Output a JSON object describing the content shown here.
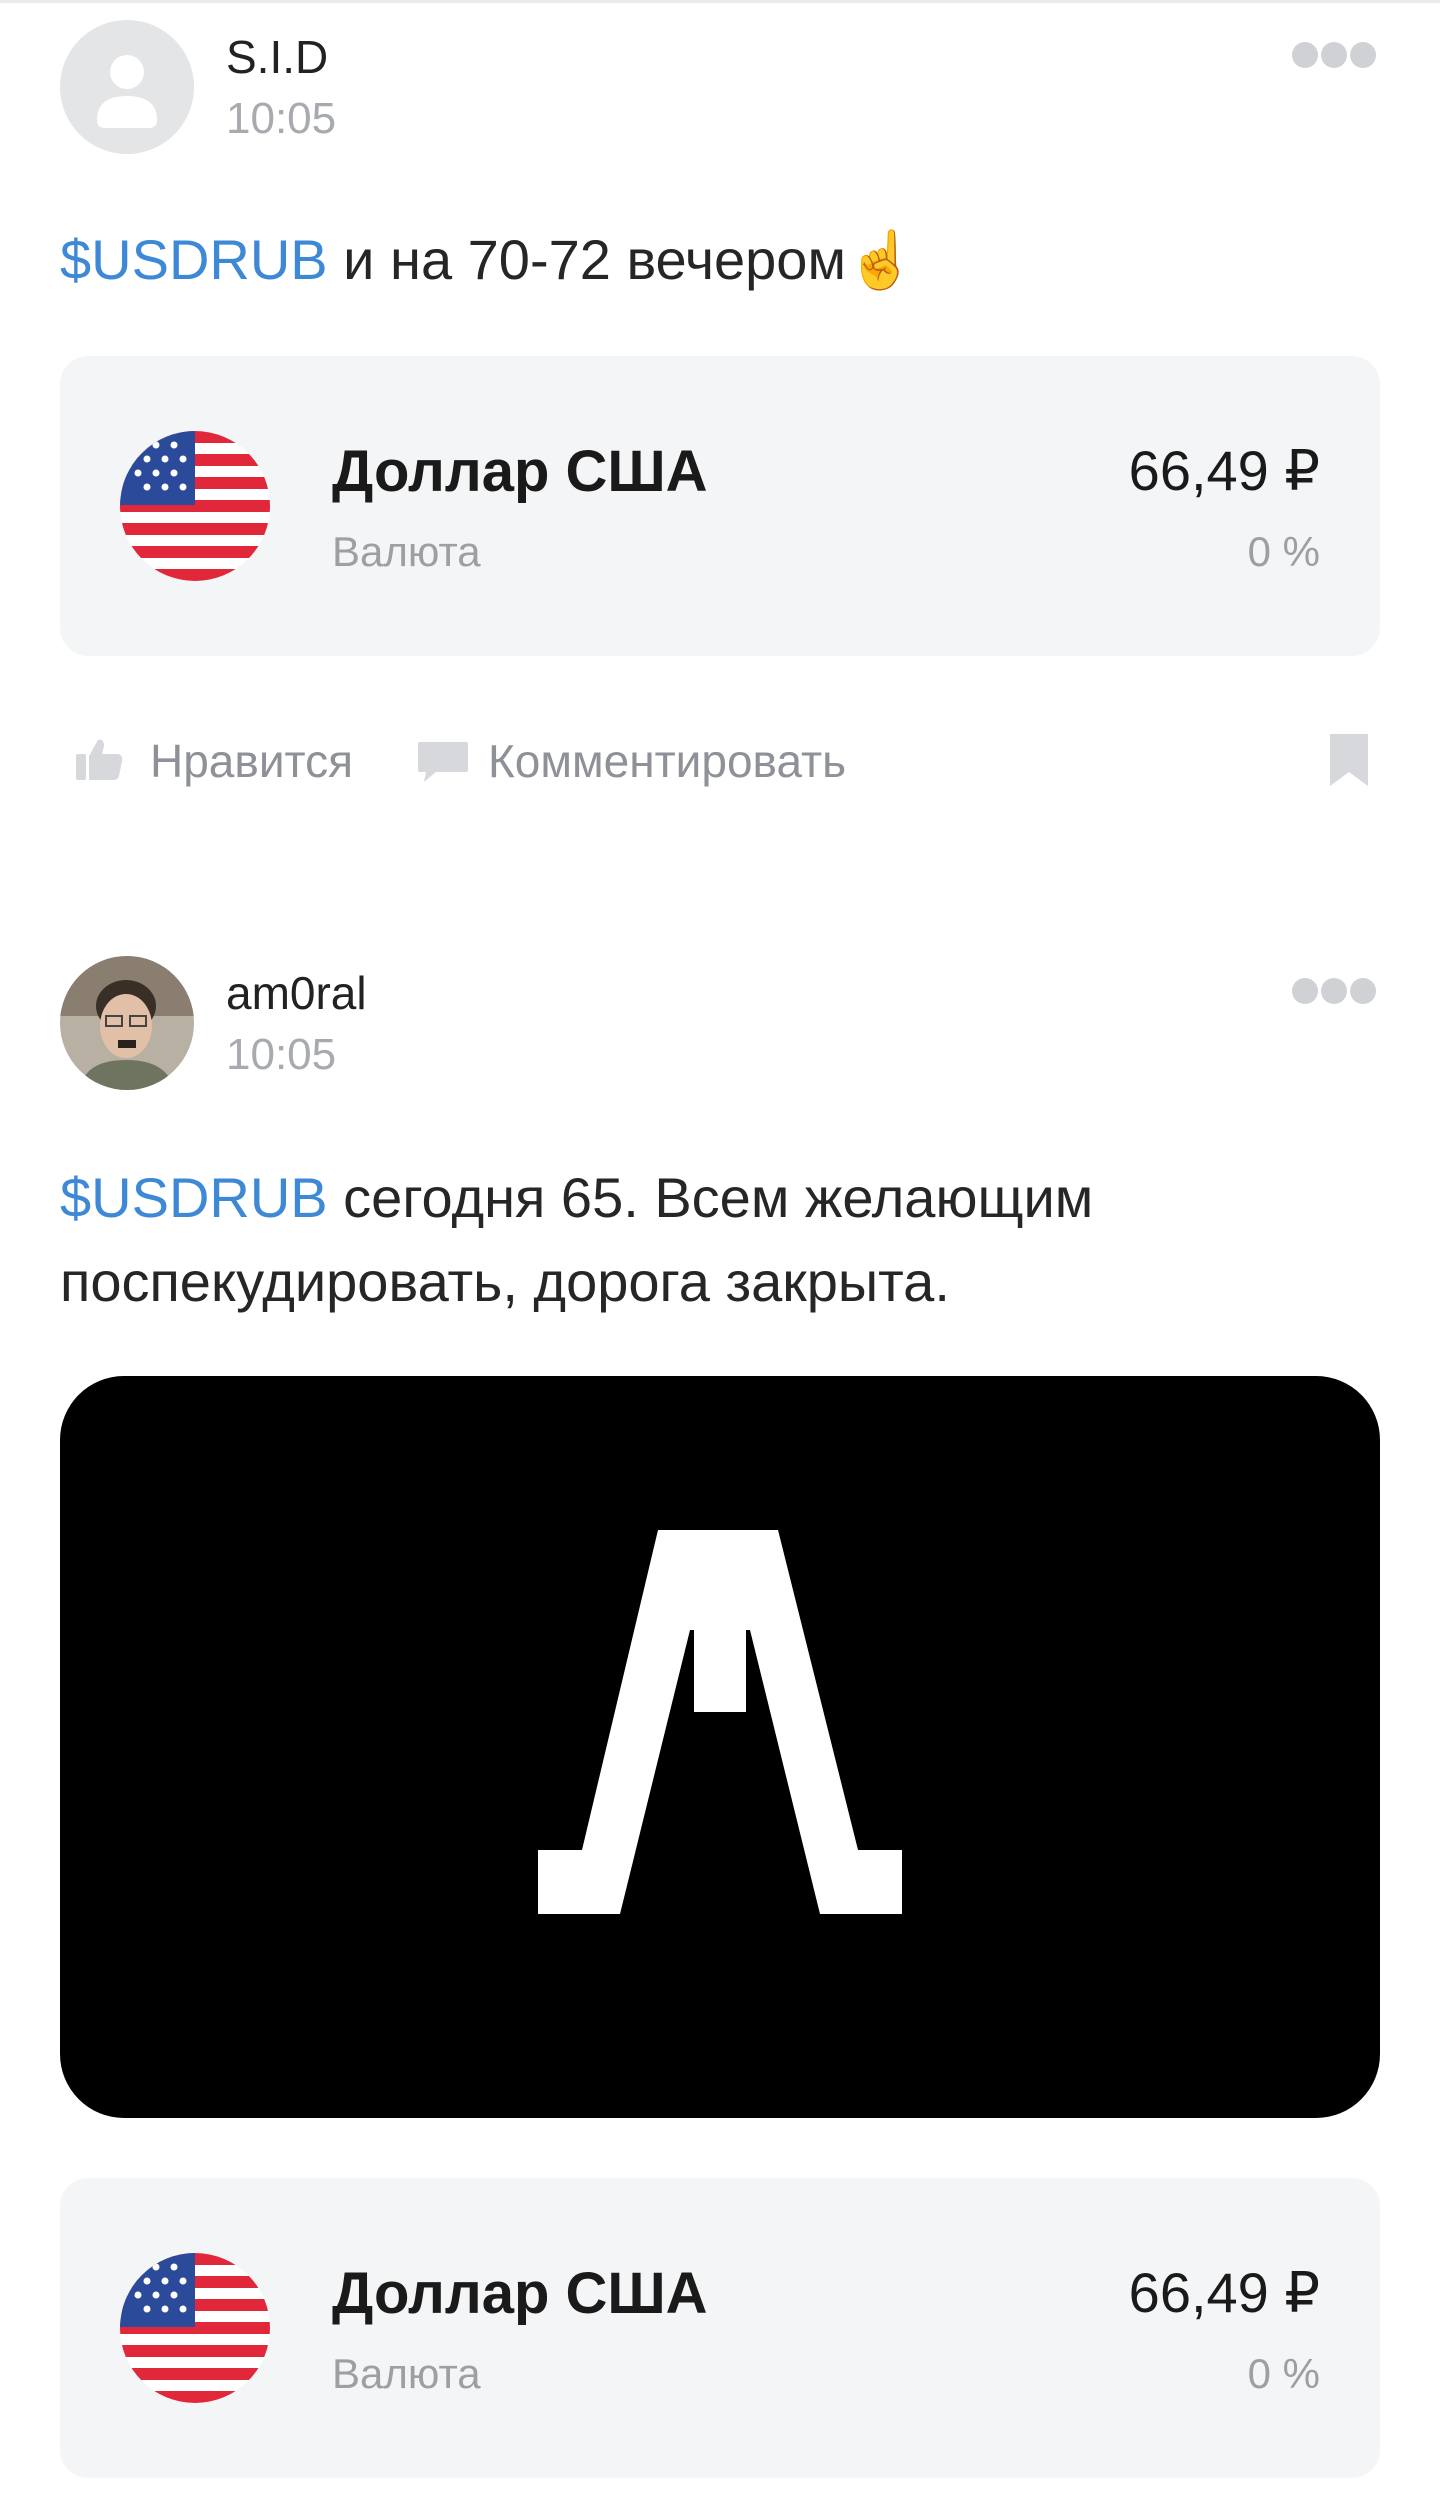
{
  "posts": [
    {
      "author": "S.I.D",
      "time": "10:05",
      "ticker": "$USDRUB",
      "text": " и на 70-72 вечером☝️",
      "instrument": {
        "name": "Доллар США",
        "type": "Валюта",
        "price": "66,49 ₽",
        "change": "0 %"
      },
      "actions": {
        "like": "Нравится",
        "comment": "Комментировать"
      }
    },
    {
      "author": "am0ral",
      "time": "10:05",
      "ticker": "$USDRUB",
      "text": " сегодня 65. Всем желающим поспекудировать, дорога закрыта.",
      "instrument": {
        "name": "Доллар США",
        "type": "Валюта",
        "price": "66,49 ₽",
        "change": "0 %"
      }
    }
  ],
  "colors": {
    "ticker": "#3e89d6",
    "card_bg": "#f4f5f6",
    "muted": "#9c9fa4"
  },
  "icons": [
    "user-placeholder-icon",
    "more-icon",
    "us-flag-icon",
    "like-icon",
    "comment-icon",
    "bookmark-icon",
    "alfa-logo-icon"
  ]
}
